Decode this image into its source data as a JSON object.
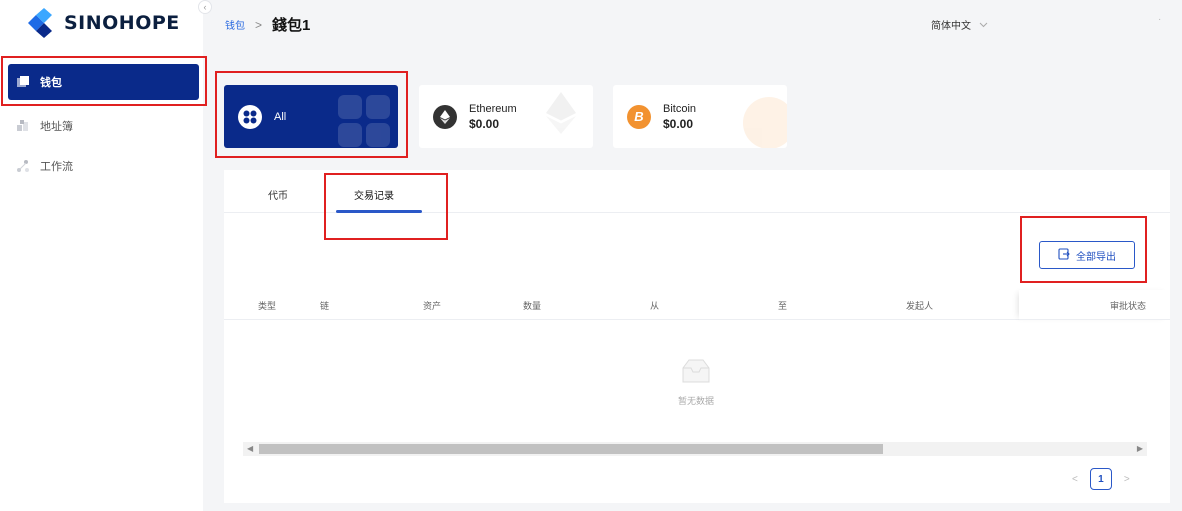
{
  "brand": {
    "name": "SINOHOPE"
  },
  "sidebar": {
    "items": [
      {
        "label": "钱包",
        "icon": "wallet-icon",
        "active": true
      },
      {
        "label": "地址簿",
        "icon": "address-book-icon",
        "active": false
      },
      {
        "label": "工作流",
        "icon": "workflow-icon",
        "active": false
      }
    ]
  },
  "header": {
    "breadcrumb_parent": "钱包",
    "breadcrumb_sep": ">",
    "breadcrumb_current": "錢包1",
    "language": "简体中文",
    "menu_dots": "·"
  },
  "assets": [
    {
      "name": "All",
      "amount": "",
      "icon": "all-assets-icon",
      "color": "#0a2a8a"
    },
    {
      "name": "Ethereum",
      "amount": "$0.00",
      "icon": "ethereum-icon",
      "color": "#333333"
    },
    {
      "name": "Bitcoin",
      "amount": "$0.00",
      "icon": "bitcoin-icon",
      "color": "#f29230"
    }
  ],
  "tabs": [
    {
      "label": "代币",
      "active": false
    },
    {
      "label": "交易记录",
      "active": true
    }
  ],
  "toolbar": {
    "export_label": "全部导出"
  },
  "table": {
    "columns": [
      "类型",
      "链",
      "资产",
      "数量",
      "从",
      "至",
      "发起人",
      "审批状态"
    ],
    "rows": [],
    "empty_text": "暂无数据"
  },
  "pagination": {
    "current_page": "1",
    "prev": "<",
    "next": ">"
  },
  "colors": {
    "primary": "#0a2a8a",
    "accent": "#2a58c8",
    "highlight": "#e02020"
  }
}
